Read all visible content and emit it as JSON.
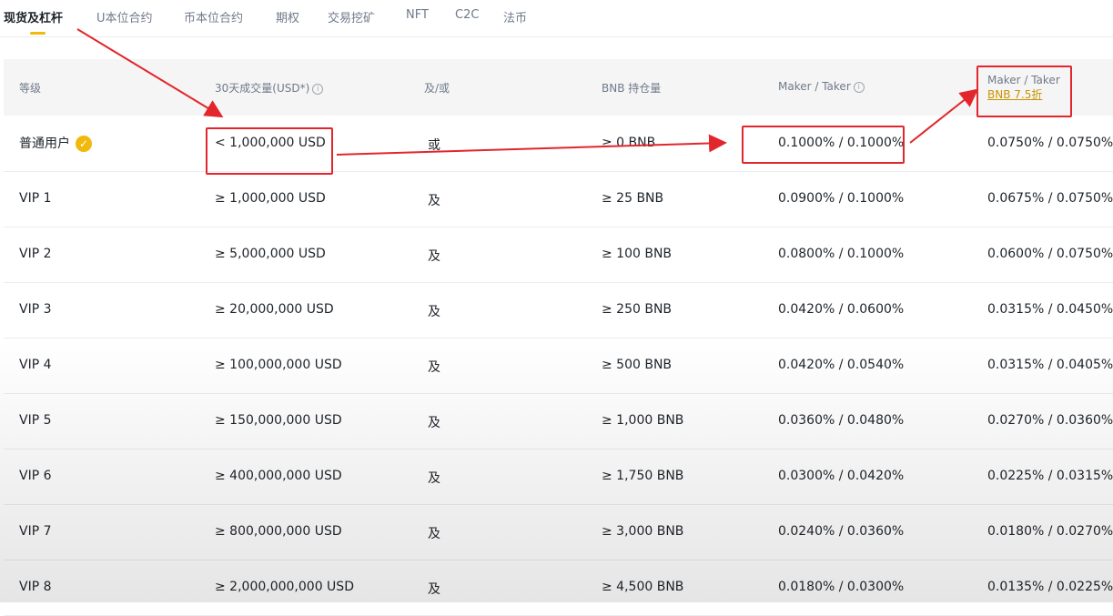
{
  "tabs": [
    {
      "label": "现货及杠杆"
    },
    {
      "label": "U本位合约"
    },
    {
      "label": "币本位合约"
    },
    {
      "label": "期权"
    },
    {
      "label": "交易挖矿"
    },
    {
      "label": "NFT"
    },
    {
      "label": "C2C"
    },
    {
      "label": "法币"
    }
  ],
  "table": {
    "headers": {
      "level": "等级",
      "volume": "30天成交量(USD*)",
      "andor": "及/或",
      "bnb": "BNB 持仓量",
      "fee": "Maker / Taker",
      "fee_bnb_title": "Maker / Taker",
      "fee_bnb_sub": "BNB 7.5折"
    },
    "rows": [
      {
        "level": "普通用户",
        "volume": "< 1,000,000 USD",
        "andor": "或",
        "bnb": "≥ 0 BNB",
        "fee": "0.1000% / 0.1000%",
        "fee_bnb": "0.0750% / 0.0750%"
      },
      {
        "level": "VIP 1",
        "volume": "≥ 1,000,000 USD",
        "andor": "及",
        "bnb": "≥ 25 BNB",
        "fee": "0.0900% / 0.1000%",
        "fee_bnb": "0.0675% / 0.0750%"
      },
      {
        "level": "VIP 2",
        "volume": "≥ 5,000,000 USD",
        "andor": "及",
        "bnb": "≥ 100 BNB",
        "fee": "0.0800% / 0.1000%",
        "fee_bnb": "0.0600% / 0.0750%"
      },
      {
        "level": "VIP 3",
        "volume": "≥ 20,000,000 USD",
        "andor": "及",
        "bnb": "≥ 250 BNB",
        "fee": "0.0420% / 0.0600%",
        "fee_bnb": "0.0315% / 0.0450%"
      },
      {
        "level": "VIP 4",
        "volume": "≥ 100,000,000 USD",
        "andor": "及",
        "bnb": "≥ 500 BNB",
        "fee": "0.0420% / 0.0540%",
        "fee_bnb": "0.0315% / 0.0405%"
      },
      {
        "level": "VIP 5",
        "volume": "≥ 150,000,000 USD",
        "andor": "及",
        "bnb": "≥ 1,000 BNB",
        "fee": "0.0360% / 0.0480%",
        "fee_bnb": "0.0270% / 0.0360%"
      },
      {
        "level": "VIP 6",
        "volume": "≥ 400,000,000 USD",
        "andor": "及",
        "bnb": "≥ 1,750 BNB",
        "fee": "0.0300% / 0.0420%",
        "fee_bnb": "0.0225% / 0.0315%"
      },
      {
        "level": "VIP 7",
        "volume": "≥ 800,000,000 USD",
        "andor": "及",
        "bnb": "≥ 3,000 BNB",
        "fee": "0.0240% / 0.0360%",
        "fee_bnb": "0.0180% / 0.0270%"
      },
      {
        "level": "VIP 8",
        "volume": "≥ 2,000,000,000 USD",
        "andor": "及",
        "bnb": "≥ 4,500 BNB",
        "fee": "0.0180% / 0.0300%",
        "fee_bnb": "0.0135% / 0.0225%"
      }
    ]
  },
  "colors": {
    "accent": "#f0b90b",
    "annotation": "#e3262b",
    "link": "#c99400"
  },
  "icons": [
    "info-icon",
    "verified-check-icon",
    "arrow-annotation"
  ]
}
